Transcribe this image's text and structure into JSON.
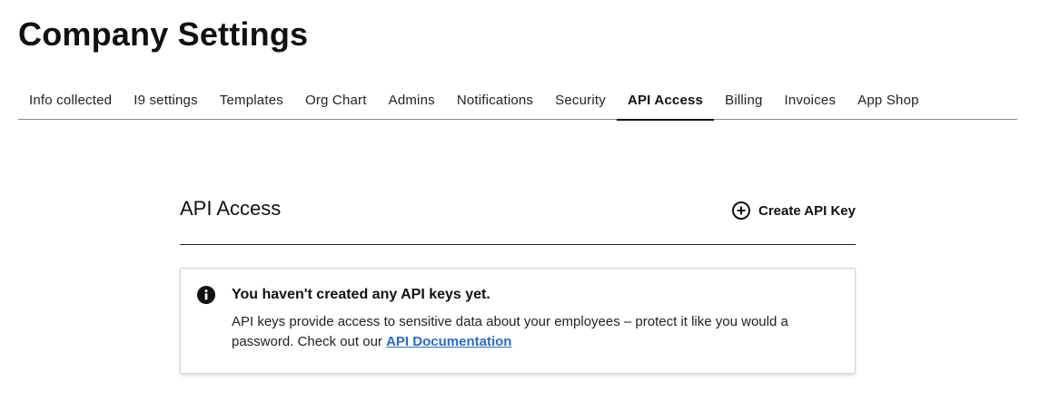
{
  "page": {
    "title": "Company Settings"
  },
  "tabs": [
    {
      "label": "Info collected",
      "active": false
    },
    {
      "label": "I9 settings",
      "active": false
    },
    {
      "label": "Templates",
      "active": false
    },
    {
      "label": "Org Chart",
      "active": false
    },
    {
      "label": "Admins",
      "active": false
    },
    {
      "label": "Notifications",
      "active": false
    },
    {
      "label": "Security",
      "active": false
    },
    {
      "label": "API Access",
      "active": true
    },
    {
      "label": "Billing",
      "active": false
    },
    {
      "label": "Invoices",
      "active": false
    },
    {
      "label": "App Shop",
      "active": false
    }
  ],
  "section": {
    "title": "API Access",
    "create_button": {
      "label": "Create API Key",
      "icon": "plus-circle-icon"
    }
  },
  "notice": {
    "icon": "info-icon",
    "title": "You haven't created any API keys yet.",
    "body_text": "API keys provide access to sensitive data about your employees – protect it like you would a password. Check out our ",
    "link_label": "API Documentation"
  },
  "colors": {
    "link": "#2b6bc7",
    "text": "#111111",
    "divider": "#8a8a8a"
  }
}
